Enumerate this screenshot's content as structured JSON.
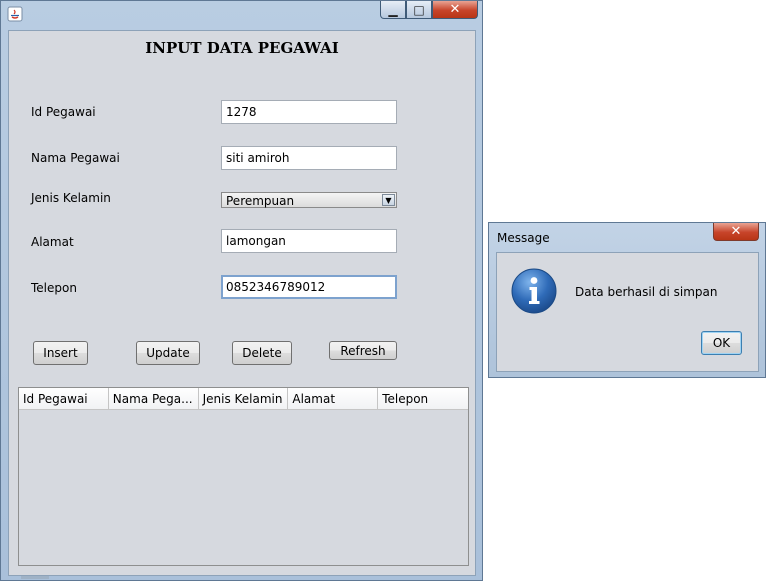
{
  "window": {
    "title_label": "",
    "form": {
      "title": "INPUT DATA PEGAWAI",
      "fields": {
        "id": {
          "label": "Id Pegawai",
          "value": "1278"
        },
        "nama": {
          "label": "Nama Pegawai",
          "value": "siti amiroh"
        },
        "jenis_kelamin": {
          "label": "Jenis Kelamin",
          "selected": "Perempuan"
        },
        "alamat": {
          "label": "Alamat",
          "value": "lamongan"
        },
        "telepon": {
          "label": "Telepon",
          "value": "0852346789012"
        }
      },
      "buttons": {
        "insert": "Insert",
        "update": "Update",
        "delete": "Delete",
        "refresh": "Refresh"
      }
    },
    "table": {
      "columns": [
        "Id Pegawai",
        "Nama Pega...",
        "Jenis Kelamin",
        "Alamat",
        "Telepon"
      ],
      "rows": []
    },
    "controls": {
      "minimize": "▁",
      "maximize": "□",
      "close": "✕"
    }
  },
  "dialog": {
    "title": "Message",
    "message": "Data berhasil di simpan",
    "ok_label": "OK",
    "close": "✕",
    "icon": "info-icon",
    "icon_color": "#2f6bb8"
  }
}
